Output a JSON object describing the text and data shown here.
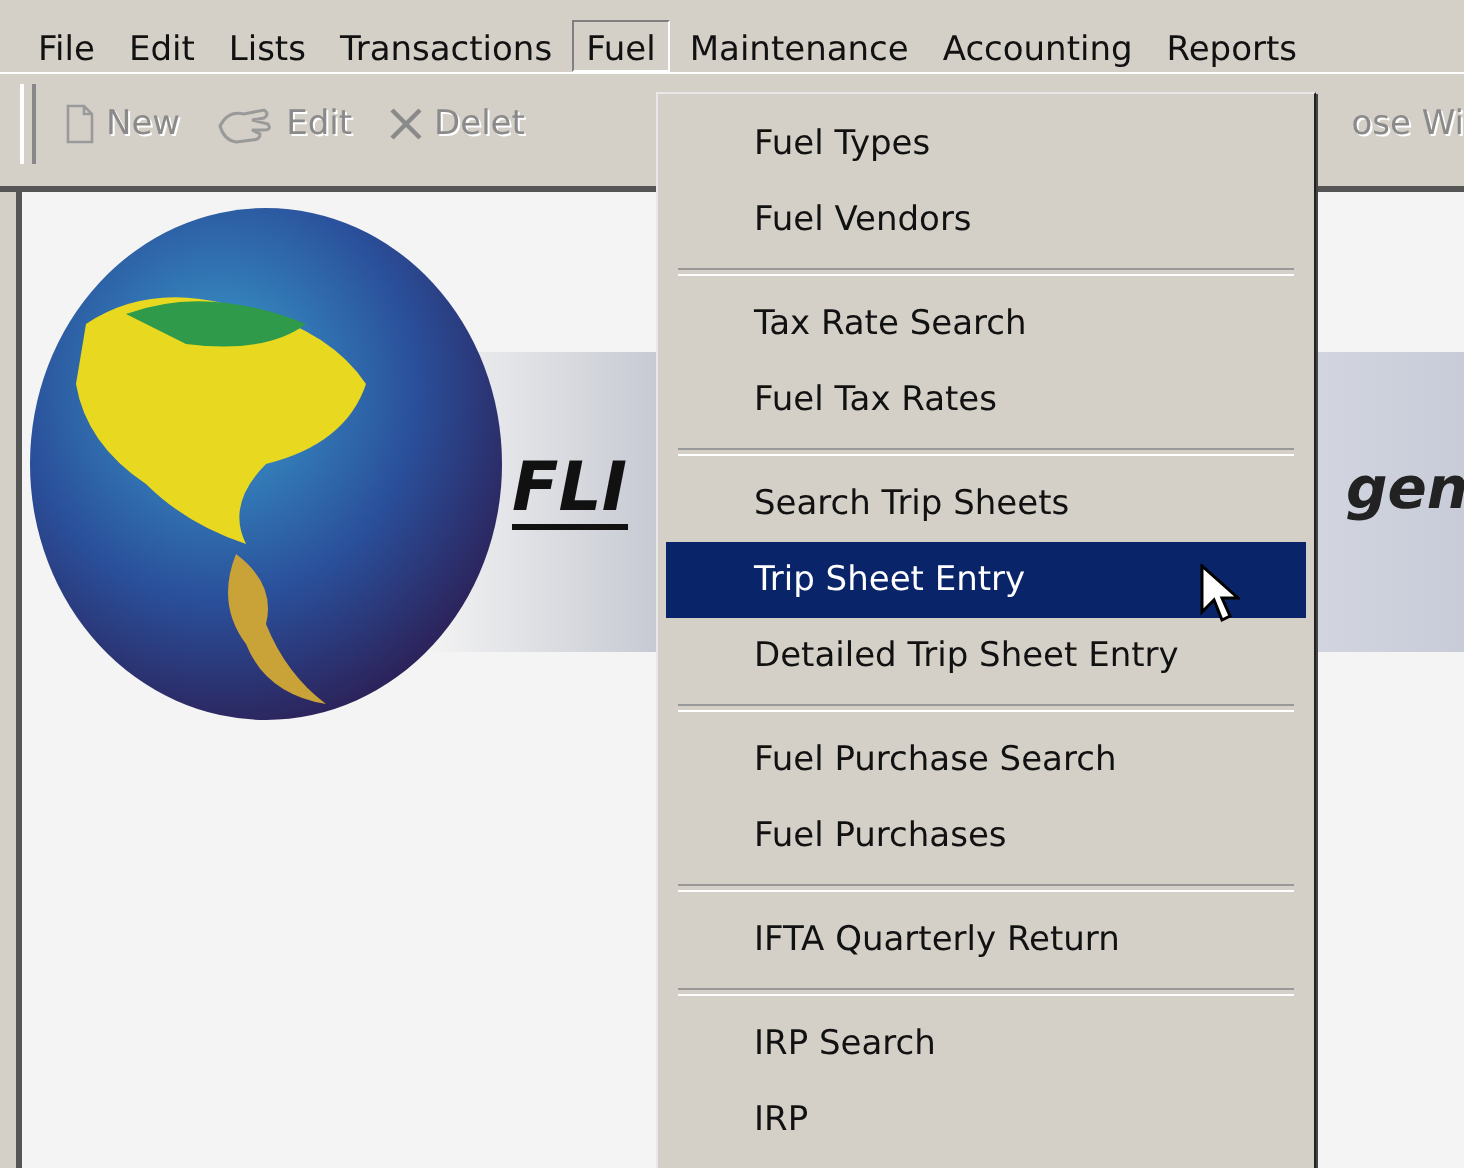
{
  "menubar": [
    {
      "label": "File",
      "selected": false
    },
    {
      "label": "Edit",
      "selected": false
    },
    {
      "label": "Lists",
      "selected": false
    },
    {
      "label": "Transactions",
      "selected": false
    },
    {
      "label": "Fuel",
      "selected": true
    },
    {
      "label": "Maintenance",
      "selected": false
    },
    {
      "label": "Accounting",
      "selected": false
    },
    {
      "label": "Reports",
      "selected": false
    }
  ],
  "toolbar": [
    {
      "label": "New",
      "disabled": true
    },
    {
      "label": "Edit",
      "disabled": true
    },
    {
      "label": "Delet",
      "disabled": true
    },
    {
      "label": "ose Wi",
      "disabled": true
    }
  ],
  "banner": {
    "logo_left": "FLI",
    "logo_right": "gen"
  },
  "fuel_menu": {
    "groups": [
      [
        {
          "label": "Fuel Types",
          "selected": false
        },
        {
          "label": "Fuel Vendors",
          "selected": false
        }
      ],
      [
        {
          "label": "Tax Rate Search",
          "selected": false
        },
        {
          "label": "Fuel Tax Rates",
          "selected": false
        }
      ],
      [
        {
          "label": "Search Trip Sheets",
          "selected": false
        },
        {
          "label": "Trip Sheet Entry",
          "selected": true
        },
        {
          "label": "Detailed Trip Sheet Entry",
          "selected": false
        }
      ],
      [
        {
          "label": "Fuel Purchase Search",
          "selected": false
        },
        {
          "label": "Fuel Purchases",
          "selected": false
        }
      ],
      [
        {
          "label": "IFTA Quarterly Return",
          "selected": false
        }
      ],
      [
        {
          "label": "IRP Search",
          "selected": false
        },
        {
          "label": "IRP",
          "selected": false
        }
      ]
    ]
  }
}
